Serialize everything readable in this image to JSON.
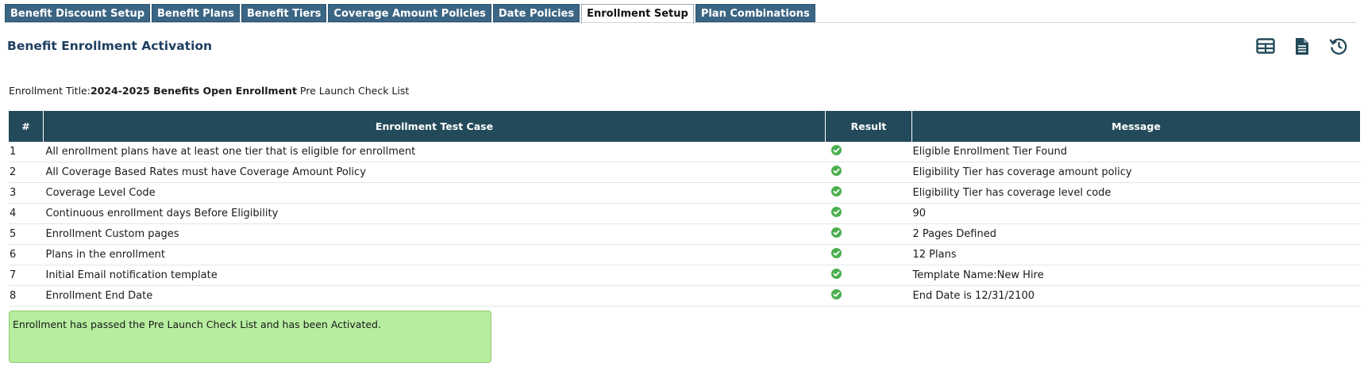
{
  "tabs": [
    {
      "label": "Benefit Discount Setup",
      "active": false
    },
    {
      "label": "Benefit Plans",
      "active": false
    },
    {
      "label": "Benefit Tiers",
      "active": false
    },
    {
      "label": "Coverage Amount Policies",
      "active": false
    },
    {
      "label": "Date Policies",
      "active": false
    },
    {
      "label": "Enrollment Setup",
      "active": true
    },
    {
      "label": "Plan Combinations",
      "active": false
    }
  ],
  "header": {
    "title": "Benefit Enrollment Activation",
    "icons": [
      "grid-view-icon",
      "document-icon",
      "history-icon"
    ]
  },
  "enrollment": {
    "label": "Enrollment Title:",
    "title": "2024-2025 Benefits Open Enrollment",
    "suffix": " Pre Launch Check List"
  },
  "table": {
    "columns": [
      "#",
      "Enrollment Test Case",
      "Result",
      "Message"
    ],
    "rows": [
      {
        "num": "1",
        "case": "All enrollment plans have at least one tier that is eligible for enrollment",
        "result": "pass",
        "message": "Eligible Enrollment Tier Found"
      },
      {
        "num": "2",
        "case": "All Coverage Based Rates must have Coverage Amount Policy",
        "result": "pass",
        "message": "Eligibility Tier has coverage amount policy"
      },
      {
        "num": "3",
        "case": "Coverage Level Code",
        "result": "pass",
        "message": "Eligibility Tier has coverage level code"
      },
      {
        "num": "4",
        "case": "Continuous enrollment days Before Eligibility",
        "result": "pass",
        "message": "90"
      },
      {
        "num": "5",
        "case": "Enrollment Custom pages",
        "result": "pass",
        "message": "2 Pages Defined"
      },
      {
        "num": "6",
        "case": "Plans in the enrollment",
        "result": "pass",
        "message": "12 Plans"
      },
      {
        "num": "7",
        "case": "Initial Email notification template",
        "result": "pass",
        "message": "Template Name:New Hire"
      },
      {
        "num": "8",
        "case": "Enrollment End Date",
        "result": "pass",
        "message": "End Date is 12/31/2100"
      }
    ]
  },
  "status": {
    "message": "Enrollment has passed the Pre Launch Check List and has been Activated."
  },
  "colors": {
    "tab_bg": "#3b6584",
    "header_bg": "#234a5a",
    "title": "#1f3f60",
    "check": "#4caf50",
    "success_bg": "#b6ed9f"
  }
}
